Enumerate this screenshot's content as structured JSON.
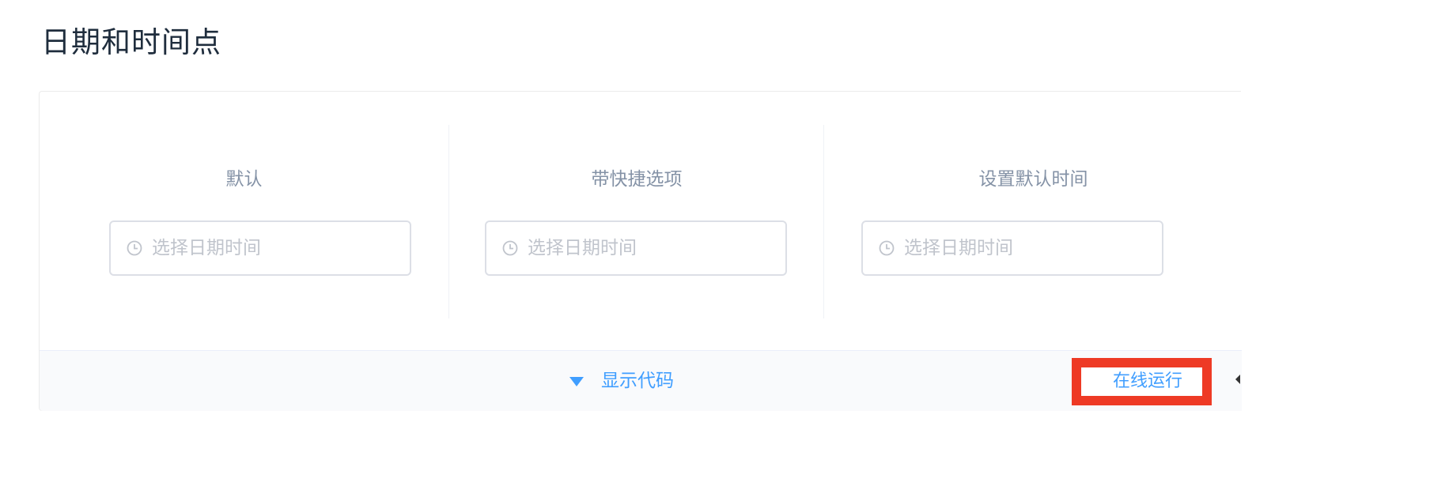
{
  "page": {
    "title": "日期和时间点"
  },
  "demos": [
    {
      "title": "默认",
      "placeholder": "选择日期时间"
    },
    {
      "title": "带快捷选项",
      "placeholder": "选择日期时间"
    },
    {
      "title": "设置默认时间",
      "placeholder": "选择日期时间"
    }
  ],
  "control": {
    "toggle_label": "显示代码",
    "run_label": "在线运行"
  },
  "icons": {
    "picker": "clock-icon",
    "toggle": "caret-down-icon"
  },
  "colors": {
    "title": "#1f2d3d",
    "block_title": "#8492a6",
    "placeholder": "#c0c4cc",
    "accent": "#409eff",
    "highlight": "#ee3a25"
  }
}
